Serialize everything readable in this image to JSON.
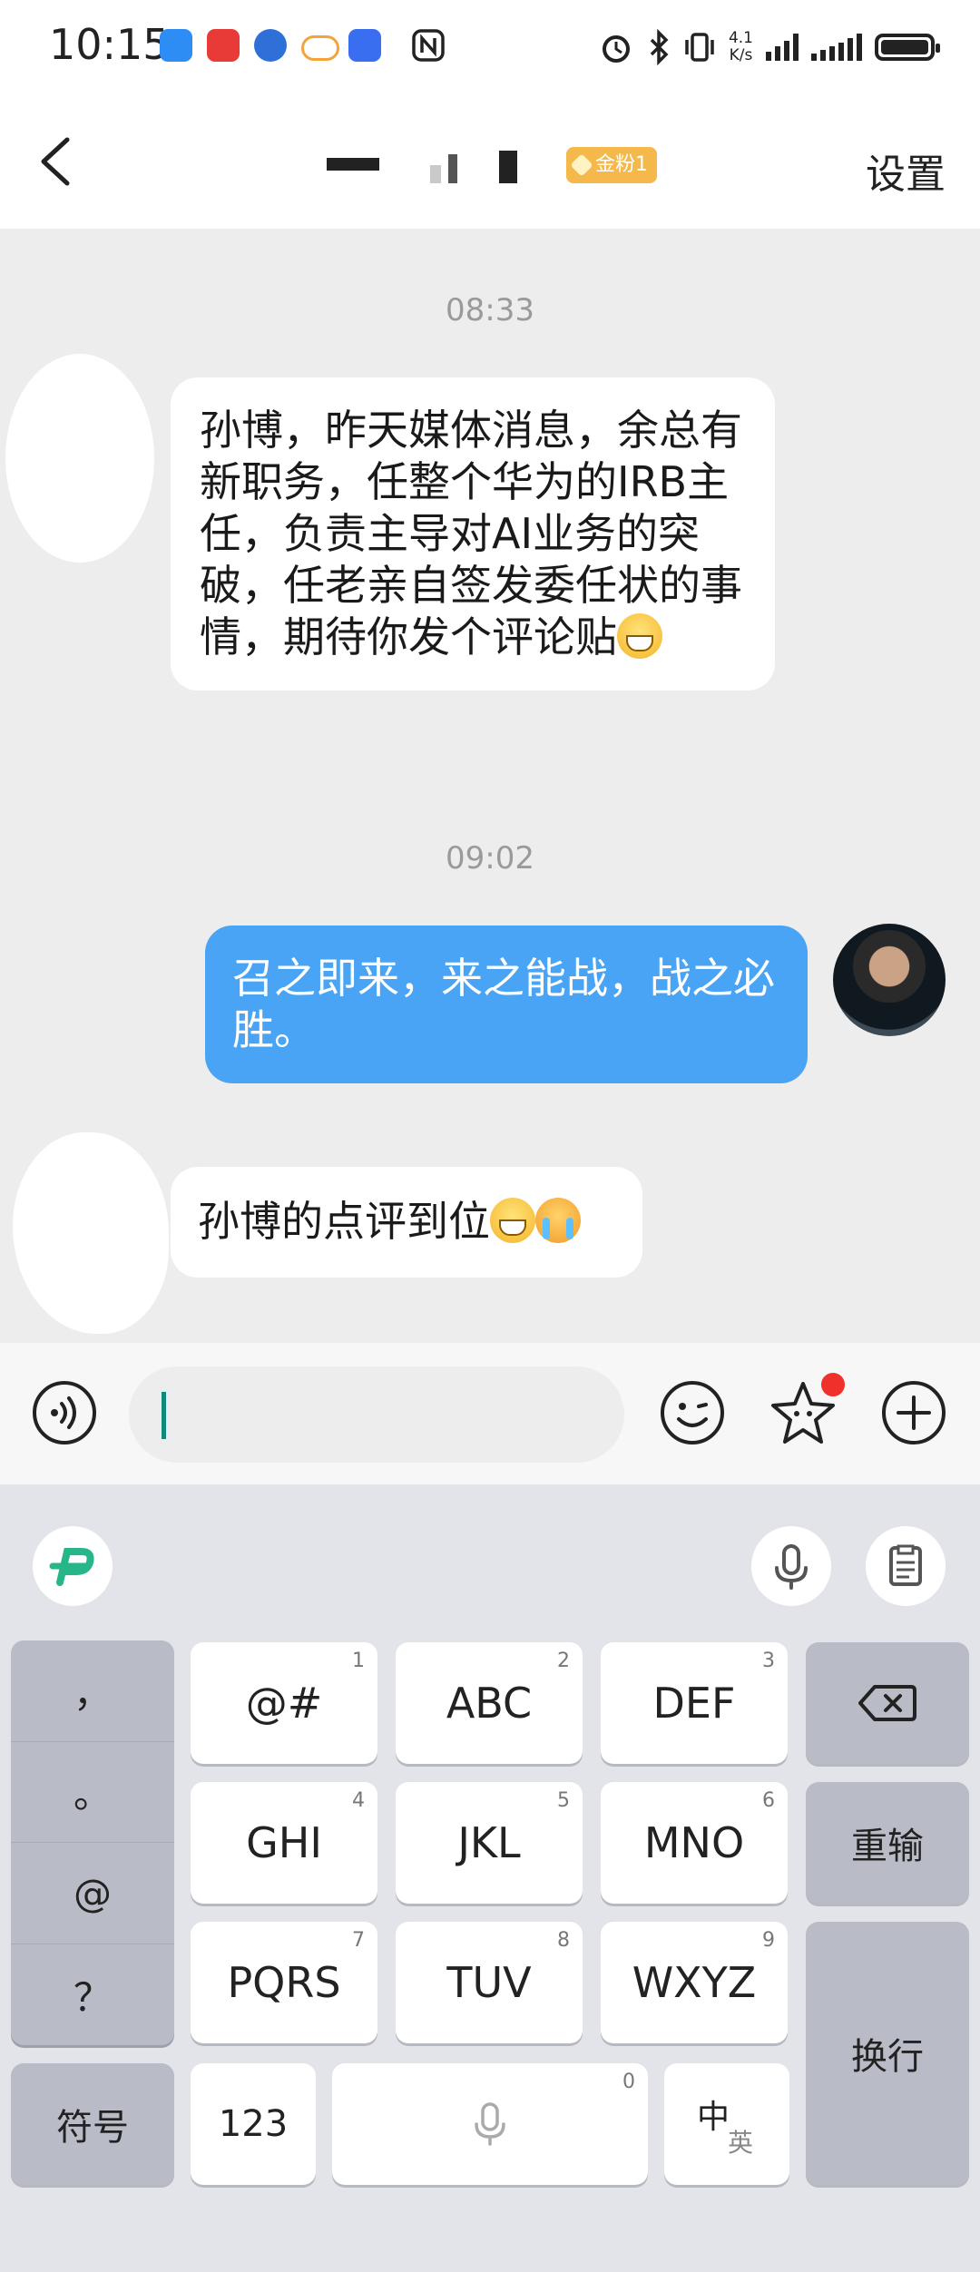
{
  "status_bar": {
    "time": "10:15",
    "net_speed_value": "4.1",
    "net_speed_unit": "K/s",
    "app_icon_colors": [
      "#2e8df5",
      "#e83a36",
      "#2f6fd8",
      "#f3a33a",
      "#3a6ef0"
    ]
  },
  "nav": {
    "badge": "金粉1",
    "settings": "设置"
  },
  "chat": {
    "messages": [
      {
        "time": "08:33",
        "text": "孙博，昨天媒体消息，余总有新职务，任整个华为的IRB主任，负责主导对AI业务的突破，任老亲自签发委任状的事情，期待你发个评论贴",
        "emoji": [
          "grin"
        ],
        "sender": "other"
      },
      {
        "time": "09:02",
        "text": "召之即来，来之能战，战之必胜。",
        "sender": "me"
      },
      {
        "text": "孙博的点评到位",
        "emoji": [
          "grin",
          "crying-laugh"
        ],
        "sender": "other"
      }
    ]
  },
  "input_bar": {
    "value": "",
    "icons": [
      "voice-icon",
      "smiley-icon",
      "sticker-icon",
      "plus-icon"
    ]
  },
  "keyboard": {
    "side_keys": [
      "，",
      "。",
      "@",
      "？"
    ],
    "grid": [
      {
        "label": "@#",
        "num": "1"
      },
      {
        "label": "ABC",
        "num": "2"
      },
      {
        "label": "DEF",
        "num": "3"
      },
      {
        "label": "GHI",
        "num": "4"
      },
      {
        "label": "JKL",
        "num": "5"
      },
      {
        "label": "MNO",
        "num": "6"
      },
      {
        "label": "PQRS",
        "num": "7"
      },
      {
        "label": "TUV",
        "num": "8"
      },
      {
        "label": "WXYZ",
        "num": "9"
      }
    ],
    "symbols": "符号",
    "num123": "123",
    "space_num": "0",
    "lang_zh": "中",
    "lang_en": "英",
    "redo": "重输",
    "enter": "换行",
    "accent": "#27b58a"
  }
}
